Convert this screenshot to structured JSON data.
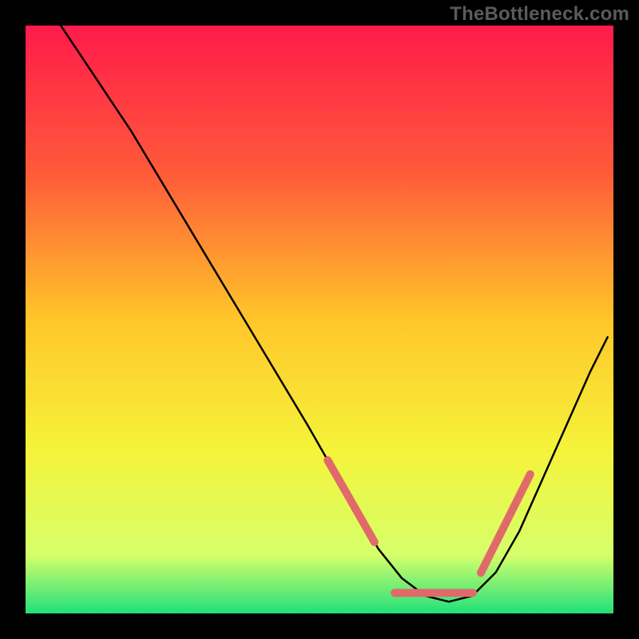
{
  "watermark": "TheBottleneck.com",
  "chart_data": {
    "type": "line",
    "title": "",
    "xlabel": "",
    "ylabel": "",
    "xlim": [
      0,
      100
    ],
    "ylim": [
      0,
      100
    ],
    "background_gradient": {
      "stops": [
        {
          "offset": 0.0,
          "color": "#ff1a4b"
        },
        {
          "offset": 0.25,
          "color": "#ff5a3a"
        },
        {
          "offset": 0.5,
          "color": "#ffc62a"
        },
        {
          "offset": 0.72,
          "color": "#f5f33a"
        },
        {
          "offset": 0.9,
          "color": "#d6ff6a"
        },
        {
          "offset": 1.0,
          "color": "#21e07a"
        }
      ]
    },
    "series": [
      {
        "name": "curve",
        "x": [
          6.0,
          12.0,
          18.0,
          24.0,
          30.0,
          36.0,
          42.0,
          48.0,
          52.0,
          56.0,
          60.0,
          64.0,
          68.0,
          72.0,
          76.0,
          80.0,
          84.0,
          88.0,
          92.0,
          96.0,
          99.0
        ],
        "y": [
          100.0,
          91.0,
          82.0,
          72.0,
          62.0,
          52.0,
          42.0,
          32.0,
          25.0,
          18.0,
          11.0,
          6.0,
          3.0,
          2.0,
          3.0,
          7.0,
          14.0,
          23.0,
          32.0,
          41.0,
          47.0
        ],
        "color": "#000000",
        "stroke_width": 2.5
      }
    ],
    "dotted_overlay": {
      "color": "#e06a6a",
      "segments": [
        {
          "x0": 52.0,
          "y0": 25.0,
          "x1": 60.0,
          "y1": 11.0
        },
        {
          "x0": 64.0,
          "y0": 3.5,
          "x1": 76.0,
          "y1": 3.5
        },
        {
          "x0": 78.0,
          "y0": 8.0,
          "x1": 86.0,
          "y1": 24.0
        }
      ]
    }
  }
}
